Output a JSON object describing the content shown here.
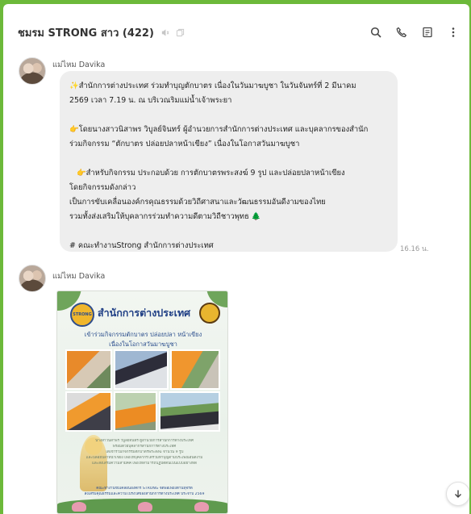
{
  "chat": {
    "title": "ชมรม STRONG สาว (422)",
    "header_icons": [
      "mute-icon",
      "copy-link-icon",
      "search-icon",
      "call-icon",
      "notes-icon",
      "more-icon"
    ]
  },
  "messages": [
    {
      "sender": "แม่ไหม Davika",
      "lines": [
        "สำนักการต่างประเทศ ร่วมทำบุญตักบาตร เนื่องในวันมาฆบูชา ในวันจันทร์ที่ 2 มีนาคม",
        "2569 เวลา 7.19 น. ณ บริเวณริมแม่น้ำเจ้าพระยา",
        "",
        "โดยนางสาวนิสาพร วิบูลย์จินทร์ ผู้อำนวยการสำนักการต่างประเทศ และบุคลากรของสำนัก",
        "ร่วมกิจกรรม “ตักบาตร ปล่อยปลาหน้าเขียง” เนื่องในโอกาสวันมาฆบูชา",
        "",
        "สำหรับกิจกรรม ประกอบด้วย การตักบาตรพระสงฆ์ 9 รูป และปล่อยปลาหน้าเขียง",
        "โดยกิจกรรมดังกล่าว",
        "เป็นการขับเคลื่อนองค์กรคุณธรรมด้วยวิถีศาสนาและวัฒนธรรมอันดีงามของไทย",
        "รวมทั้งส่งเสริมให้บุคลากรร่วมทำความดีตามวิถีชาวพุทธ",
        "",
        "# คณะทำงานStrong สำนักการต่างประเทศ"
      ],
      "time": "16.16 น."
    },
    {
      "sender": "แม่ไหม Davika",
      "image": {
        "title": "สำนักการต่างประเทศ",
        "subtitle_1": "เข้าร่วมกิจกรรมตักบาตร ปล่อยปลา หน้าเขียง",
        "subtitle_2": "เนื่องในโอกาสวันมาฆบูชา",
        "body_lines": [
          "นางสาวนิสาพร วิบูลย์จินทร์ ผู้อำนวยการสำนักการต่างประเทศ",
          "พร้อมด้วยบุคลากรสำนักการต่างประเทศ",
          "ได้เข้าร่วมกิจกรรมตักบาตรพระสงฆ์ จำนวน 9 รูป",
          "และปล่อยปลาหน้าเขียง เพื่อให้บุคลากรได้ร่วมทำบุญตามประเพณีอันดีงาม",
          "และส่งเสริมความสามัคคี เพื่อให้สามารถปฏิบัติตนเป็นแบบอย่างที่ดี"
        ],
        "footer_lines": [
          "คณะทำงานขับเคลื่อนองค์กร STRONG จิตพอเพียงต้านทุจริต",
          "ส่งเสริมคุณธรรมและความโปร่งใสของสำนักการต่างประเทศ ประจำปี 2569"
        ]
      }
    }
  ],
  "scroll_button": {
    "icon": "arrow-down-icon"
  },
  "colors": {
    "frame": "#6cb93a",
    "bubble": "#eeeeee",
    "poster_title": "#1f3f85",
    "accent": "#2f4e8c"
  }
}
